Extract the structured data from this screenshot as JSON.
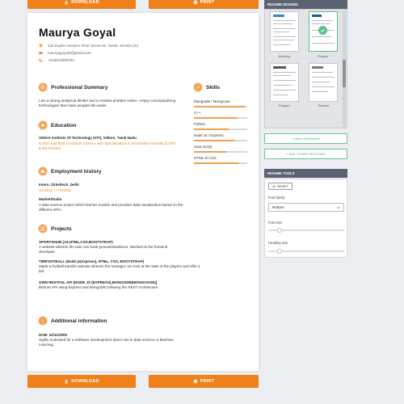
{
  "actions": {
    "download": "DOWNLOAD",
    "print": "PRINT"
  },
  "resume": {
    "name": "Maurya Goyal",
    "address": "132 Duplex Sivanim Vihar Sector 82, Noida, 201304 (In)",
    "email": "mauryagoyal2@gmail.com",
    "phone": "+918818099753",
    "summary_title": "Professional Summary",
    "summary_text": "I am a strong analytical thinker and a creative problem solver. I enjoy conceptualizing technologies that make peoples life easier.",
    "education_title": "Education",
    "edu_school": "Vellore Institute Of Technology (VIT), Vellore, Tamil Nadu",
    "edu_degree": "B.Tech and then Computer Science with specialization in Information Security (CGPA 8.59) Present",
    "employment_title": "Employment history",
    "emp_role": "Intern, Zirkeltech. Delhi",
    "emp_dates": "Jul 2021 — Present",
    "emp_company": "MarketStudio",
    "emp_desc": "A data science project which fetches models and provides data visualization based on the different API's.",
    "projects_title": "Projects",
    "projects": [
      {
        "title": "SPORTSHUB (JS,HTML,CSS,BOOTSTRAP)",
        "desc": "A website wherein the user can book grounds/stadiums. Worked as the frontend developer."
      },
      {
        "title": "TIMFOOTBALL (Node js(express), HTML, CSS, BOOTSTRAP)",
        "desc": "Made a football transfer website wherein the manager can look at the stats of the players and offer a bid."
      },
      {
        "title": "OWN RESTFUL API (NODE JS (EXPRESS),MONGODB(MONGOOSE))",
        "desc": "Built an API using Express and MongoDB following the REST Architecture."
      }
    ],
    "additional_title": "Additional information",
    "dob": "DOB: 20/11/2000",
    "additional_text": "Highly motivated for a Software Development Intern role in data science or Machine Learning.",
    "skills_title": "Skills",
    "skills": [
      {
        "name": "MongoDB / Mongoose",
        "level": 0.95
      },
      {
        "name": "C++",
        "level": 0.8
      },
      {
        "name": "Python",
        "level": 0.65
      },
      {
        "name": "Node Js / Express",
        "level": 0.75
      },
      {
        "name": "Java Script",
        "level": 0.6
      },
      {
        "name": "HTML 5/ CSS",
        "level": 0.85
      }
    ]
  },
  "sidebar": {
    "designs_title": "RESUME DESIGNS",
    "designs": [
      {
        "label": "Anthony",
        "selected": false
      },
      {
        "label": "Pugner",
        "selected": true
      },
      {
        "label": "Elegant",
        "selected": false
      },
      {
        "label": "Tessam",
        "selected": false
      }
    ],
    "add_language": "+ ADD LANGUAGE",
    "add_other": "+ ADD OTHER SECTIONS",
    "tools_title": "RESUME TOOLS",
    "reset": "RESET",
    "font_family_label": "Font family",
    "font_family_value": "Roboto",
    "font_size_label": "Font size",
    "font_size_level": 0.12,
    "heading_size_label": "Heading size",
    "heading_size_level": 0.12
  },
  "colors": {
    "accent": "#f0801a",
    "panel": "#5b6372",
    "add": "#4aa87a"
  }
}
